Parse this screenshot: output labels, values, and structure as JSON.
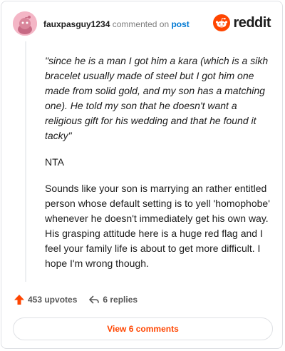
{
  "header": {
    "username": "fauxpasguy1234",
    "commented_on": "commented on",
    "post_link": "post"
  },
  "brand": {
    "logo_text": "reddit",
    "brand_color": "#ff4500",
    "link_color": "#0079d3"
  },
  "comment": {
    "quote": "\"since he is a man I got him a kara (which is a sikh bracelet usually made of steel but I got him one made from solid gold, and my son has a matching one). He told my son that he doesn't want a religious gift for his wedding and that he found it tacky\"",
    "verdict": "NTA",
    "body": "Sounds like your son is marrying an rather entitled person whose default setting is to yell 'homophobe' whenever he doesn't immediately get his own way. His grasping attitude here is a huge red flag and I feel your family life is about to get more difficult. I hope I'm wrong though."
  },
  "actions": {
    "upvotes_label": "453 upvotes",
    "replies_label": "6 replies",
    "upvote_icon": "upvote-arrow-icon",
    "reply_icon": "reply-arrow-icon"
  },
  "footer": {
    "view_comments_label": "View 6 comments"
  }
}
